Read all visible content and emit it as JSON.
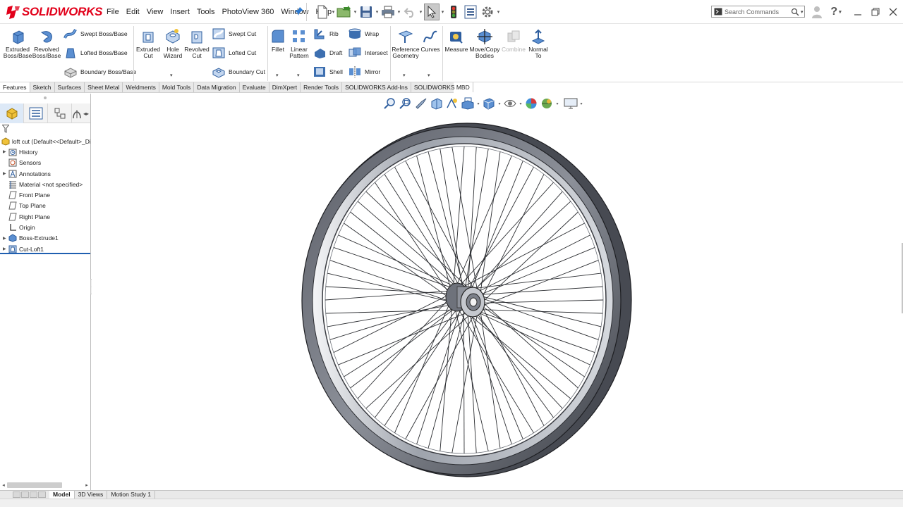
{
  "app": {
    "brand": "SOLIDWORKS",
    "brand_color": "#e2001a",
    "accent_color": "#1f5fb0"
  },
  "menu": [
    "File",
    "Edit",
    "View",
    "Insert",
    "Tools",
    "PhotoView 360",
    "Window",
    "Help"
  ],
  "search": {
    "placeholder": "Search Commands"
  },
  "ribbon": {
    "extruded_boss": "Extruded Boss/Base",
    "revolved_boss": "Revolved Boss/Base",
    "swept_boss": "Swept Boss/Base",
    "lofted_boss": "Lofted Boss/Base",
    "boundary_boss": "Boundary Boss/Base",
    "extruded_cut": "Extruded Cut",
    "hole_wizard": "Hole Wizard",
    "revolved_cut": "Revolved Cut",
    "swept_cut": "Swept Cut",
    "lofted_cut": "Lofted Cut",
    "boundary_cut": "Boundary Cut",
    "fillet": "Fillet",
    "linear_pattern": "Linear Pattern",
    "rib": "Rib",
    "draft": "Draft",
    "shell": "Shell",
    "wrap": "Wrap",
    "intersect": "Intersect",
    "mirror": "Mirror",
    "reference_geometry": "Reference Geometry",
    "curves": "Curves",
    "measure": "Measure",
    "move_copy": "Move/Copy Bodies",
    "combine": "Combine",
    "normal_to": "Normal To"
  },
  "tabs": [
    "Features",
    "Sketch",
    "Surfaces",
    "Sheet Metal",
    "Weldments",
    "Mold Tools",
    "Data Migration",
    "Evaluate",
    "DimXpert",
    "Render Tools",
    "SOLIDWORKS Add-Ins",
    "SOLIDWORKS MBD"
  ],
  "feature_tree": {
    "root": "loft cut  (Default<<Default>_Di",
    "items": [
      {
        "label": "History",
        "icon": "history-folder-icon",
        "expandable": true
      },
      {
        "label": "Sensors",
        "icon": "sensors-icon",
        "expandable": false
      },
      {
        "label": "Annotations",
        "icon": "annotations-icon",
        "expandable": true
      },
      {
        "label": "Material <not specified>",
        "icon": "material-icon",
        "expandable": false
      },
      {
        "label": "Front Plane",
        "icon": "plane-icon",
        "expandable": false
      },
      {
        "label": "Top Plane",
        "icon": "plane-icon",
        "expandable": false
      },
      {
        "label": "Right Plane",
        "icon": "plane-icon",
        "expandable": false
      },
      {
        "label": "Origin",
        "icon": "origin-icon",
        "expandable": false
      },
      {
        "label": "Boss-Extrude1",
        "icon": "boss-extrude-icon",
        "expandable": true
      },
      {
        "label": "Cut-Loft1",
        "icon": "cut-loft-icon",
        "expandable": true
      }
    ]
  },
  "bottom_tabs": [
    "Model",
    "3D Views",
    "Motion Study 1"
  ]
}
